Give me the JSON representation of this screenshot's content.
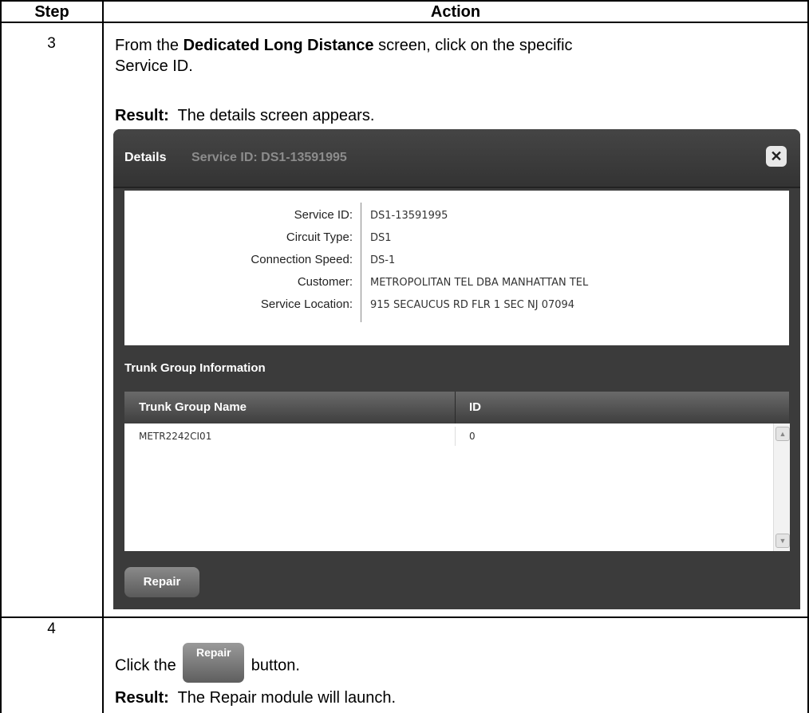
{
  "table": {
    "header_step": "Step",
    "header_action": "Action"
  },
  "step3": {
    "number": "3",
    "line1_prefix": "From the ",
    "line1_bold": "Dedicated Long Distance",
    "line1_suffix": " screen, click on the specific",
    "line2": "Service ID.",
    "result_label": "Result:",
    "result_text": "The details screen appears."
  },
  "dialog": {
    "title": "Details",
    "subtitle": "Service ID: DS1-13591995",
    "close_glyph": "✕",
    "fields": [
      {
        "label": "Service ID:",
        "value": "DS1-13591995"
      },
      {
        "label": "Circuit Type:",
        "value": "DS1"
      },
      {
        "label": "Connection Speed:",
        "value": "DS-1"
      },
      {
        "label": "Customer:",
        "value": "METROPOLITAN TEL DBA MANHATTAN TEL"
      },
      {
        "label": "Service Location:",
        "value": "915 SECAUCUS RD FLR 1 SEC NJ 07094"
      }
    ],
    "trunk_title": "Trunk Group Information",
    "columns": [
      "Trunk Group Name",
      "ID"
    ],
    "rows": [
      {
        "name": "METR2242CI01",
        "id": "0"
      }
    ],
    "repair_label": "Repair"
  },
  "step4": {
    "number": "4",
    "click_prefix": "Click the ",
    "button_label": "Repair",
    "click_suffix": " button.",
    "result_label": "Result:",
    "result_text": "The Repair module will launch."
  }
}
